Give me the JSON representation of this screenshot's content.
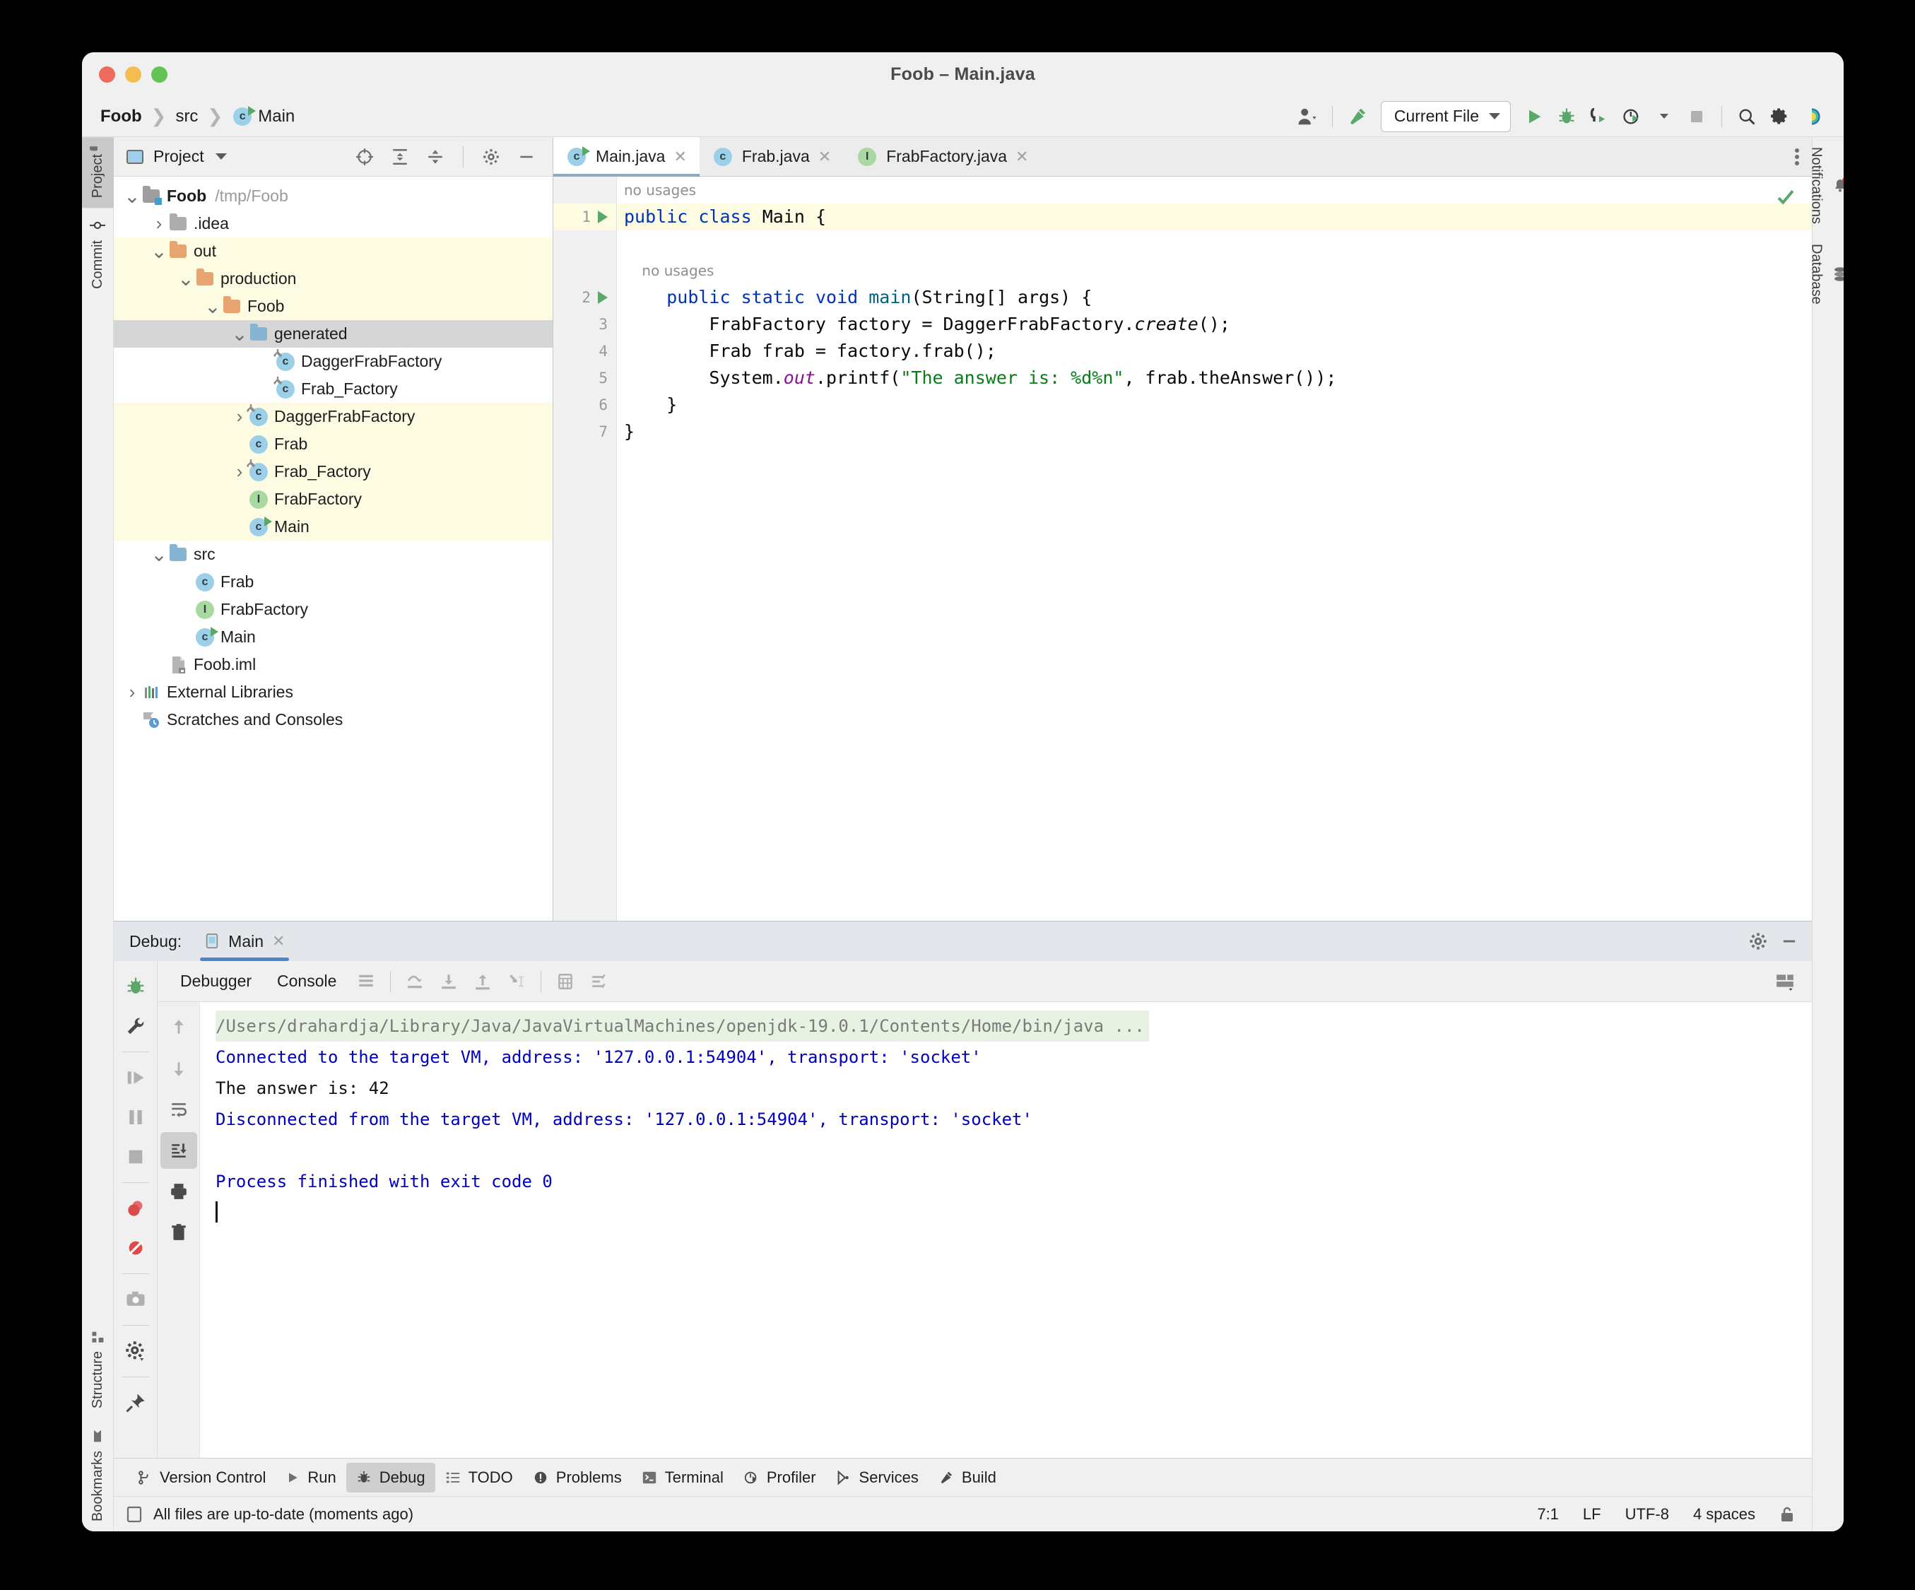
{
  "window": {
    "title": "Foob – Main.java"
  },
  "navbar": {
    "breadcrumbs": [
      {
        "label": "Foob",
        "icon": null,
        "bold": true
      },
      {
        "label": "src",
        "icon": null,
        "bold": false
      },
      {
        "label": "Main",
        "icon": "java-class-run-icon",
        "bold": false
      }
    ],
    "separator": "❯",
    "run_config": {
      "label": "Current File",
      "icon": "chevron-down-icon"
    },
    "buttons": [
      {
        "name": "account-icon",
        "label": ""
      },
      {
        "name": "build-hammer-icon",
        "label": ""
      },
      {
        "name": "run-icon",
        "label": ""
      },
      {
        "name": "debug-icon",
        "label": ""
      },
      {
        "name": "run-with-coverage-icon",
        "label": ""
      },
      {
        "name": "profiler-icon",
        "label": ""
      },
      {
        "name": "stop-icon",
        "label": ""
      },
      {
        "name": "search-icon",
        "label": ""
      },
      {
        "name": "settings-gear-icon",
        "label": ""
      },
      {
        "name": "ai-assistant-icon",
        "label": ""
      }
    ]
  },
  "left_rail": {
    "top": [
      {
        "label": "Project",
        "icon": "project-folder-icon",
        "active": true
      },
      {
        "label": "Commit",
        "icon": "commit-icon",
        "active": false
      }
    ],
    "bottom": [
      {
        "label": "Structure",
        "icon": "structure-icon",
        "active": false
      },
      {
        "label": "Bookmarks",
        "icon": "bookmark-icon",
        "active": false
      }
    ]
  },
  "right_rail": {
    "items": [
      {
        "label": "Notifications",
        "icon": "notifications-bell-icon"
      },
      {
        "label": "Database",
        "icon": "database-icon"
      }
    ]
  },
  "project_panel": {
    "title": "Project",
    "tools": [
      "locate-icon",
      "expand-all-icon",
      "collapse-all-icon",
      "settings-gear-icon",
      "hide-icon"
    ],
    "tree": [
      {
        "depth": 0,
        "label": "Foob",
        "suffix": "/tmp/Foob",
        "icon": "module-folder-icon",
        "arrow": "down",
        "bold": true,
        "hl": "none"
      },
      {
        "depth": 1,
        "label": ".idea",
        "suffix": "",
        "icon": "folder-grey-icon",
        "arrow": "right",
        "bold": false,
        "hl": "none"
      },
      {
        "depth": 1,
        "label": "out",
        "suffix": "",
        "icon": "folder-orange-icon",
        "arrow": "down",
        "bold": false,
        "hl": "yellow"
      },
      {
        "depth": 2,
        "label": "production",
        "suffix": "",
        "icon": "folder-orange-icon",
        "arrow": "down",
        "bold": false,
        "hl": "yellow"
      },
      {
        "depth": 3,
        "label": "Foob",
        "suffix": "",
        "icon": "folder-orange-icon",
        "arrow": "down",
        "bold": false,
        "hl": "yellow"
      },
      {
        "depth": 4,
        "label": "generated",
        "suffix": "",
        "icon": "folder-blue-icon",
        "arrow": "down",
        "bold": false,
        "hl": "grey"
      },
      {
        "depth": 5,
        "label": "DaggerFrabFactory",
        "suffix": "",
        "icon": "class-generated-icon",
        "arrow": "none",
        "bold": false,
        "hl": "none"
      },
      {
        "depth": 5,
        "label": "Frab_Factory",
        "suffix": "",
        "icon": "class-generated-icon",
        "arrow": "none",
        "bold": false,
        "hl": "none"
      },
      {
        "depth": 4,
        "label": "DaggerFrabFactory",
        "suffix": "",
        "icon": "class-generated-icon",
        "arrow": "right",
        "bold": false,
        "hl": "yellow"
      },
      {
        "depth": 4,
        "label": "Frab",
        "suffix": "",
        "icon": "class-icon",
        "arrow": "none",
        "bold": false,
        "hl": "yellow"
      },
      {
        "depth": 4,
        "label": "Frab_Factory",
        "suffix": "",
        "icon": "class-generated-icon",
        "arrow": "right",
        "bold": false,
        "hl": "yellow"
      },
      {
        "depth": 4,
        "label": "FrabFactory",
        "suffix": "",
        "icon": "interface-icon",
        "arrow": "none",
        "bold": false,
        "hl": "yellow"
      },
      {
        "depth": 4,
        "label": "Main",
        "suffix": "",
        "icon": "class-run-icon",
        "arrow": "none",
        "bold": false,
        "hl": "yellow"
      },
      {
        "depth": 1,
        "label": "src",
        "suffix": "",
        "icon": "folder-blue-icon",
        "arrow": "down",
        "bold": false,
        "hl": "none"
      },
      {
        "depth": 2,
        "label": "Frab",
        "suffix": "",
        "icon": "class-icon",
        "arrow": "none",
        "bold": false,
        "hl": "none"
      },
      {
        "depth": 2,
        "label": "FrabFactory",
        "suffix": "",
        "icon": "interface-icon",
        "arrow": "none",
        "bold": false,
        "hl": "none"
      },
      {
        "depth": 2,
        "label": "Main",
        "suffix": "",
        "icon": "class-run-icon",
        "arrow": "none",
        "bold": false,
        "hl": "none"
      },
      {
        "depth": 1,
        "label": "Foob.iml",
        "suffix": "",
        "icon": "iml-file-icon",
        "arrow": "none",
        "bold": false,
        "hl": "none"
      },
      {
        "depth": 0,
        "label": "External Libraries",
        "suffix": "",
        "icon": "libraries-icon",
        "arrow": "right",
        "bold": false,
        "hl": "none"
      },
      {
        "depth": 0,
        "label": "Scratches and Consoles",
        "suffix": "",
        "icon": "scratches-icon",
        "arrow": "none",
        "bold": false,
        "hl": "none"
      }
    ]
  },
  "editor": {
    "tabs": [
      {
        "label": "Main.java",
        "icon": "class-run-icon",
        "active": true
      },
      {
        "label": "Frab.java",
        "icon": "class-icon",
        "active": false
      },
      {
        "label": "FrabFactory.java",
        "icon": "interface-icon",
        "active": false
      }
    ],
    "inspection_status": "ok-checkmark-icon",
    "gutter_lines": [
      "1",
      "2",
      "3",
      "4",
      "5",
      "6",
      "7"
    ],
    "hints": {
      "no_usages": "no usages"
    },
    "code_lines": [
      {
        "num": "",
        "type": "hint",
        "text": "no usages"
      },
      {
        "num": "1",
        "type": "code",
        "highlight": true,
        "run": true,
        "tokens": [
          {
            "t": "public",
            "c": "kw"
          },
          {
            "t": " ",
            "c": ""
          },
          {
            "t": "class",
            "c": "kw"
          },
          {
            "t": " Main {",
            "c": ""
          }
        ]
      },
      {
        "num": "",
        "type": "blank",
        "text": ""
      },
      {
        "num": "",
        "type": "hint",
        "text": "no usages",
        "indent": 1
      },
      {
        "num": "2",
        "type": "code",
        "highlight": false,
        "run": true,
        "fold": "open",
        "tokens": [
          {
            "t": "    ",
            "c": ""
          },
          {
            "t": "public",
            "c": "kw"
          },
          {
            "t": " ",
            "c": ""
          },
          {
            "t": "static",
            "c": "kw"
          },
          {
            "t": " ",
            "c": ""
          },
          {
            "t": "void",
            "c": "kw"
          },
          {
            "t": " ",
            "c": ""
          },
          {
            "t": "main",
            "c": "mth"
          },
          {
            "t": "(String[] args) {",
            "c": ""
          }
        ]
      },
      {
        "num": "3",
        "type": "code",
        "highlight": false,
        "tokens": [
          {
            "t": "        FrabFactory factory = DaggerFrabFactory.",
            "c": ""
          },
          {
            "t": "create",
            "c": "ital"
          },
          {
            "t": "();",
            "c": ""
          }
        ]
      },
      {
        "num": "4",
        "type": "code",
        "highlight": false,
        "tokens": [
          {
            "t": "        Frab frab = factory.frab();",
            "c": ""
          }
        ]
      },
      {
        "num": "5",
        "type": "code",
        "highlight": false,
        "tokens": [
          {
            "t": "        System.",
            "c": ""
          },
          {
            "t": "out",
            "c": "fld"
          },
          {
            "t": ".printf(",
            "c": ""
          },
          {
            "t": "\"The answer is: %d%n\"",
            "c": "str"
          },
          {
            "t": ", frab.theAnswer());",
            "c": ""
          }
        ]
      },
      {
        "num": "6",
        "type": "code",
        "highlight": false,
        "fold": "close",
        "tokens": [
          {
            "t": "    }",
            "c": ""
          }
        ]
      },
      {
        "num": "7",
        "type": "code",
        "highlight": false,
        "tokens": [
          {
            "t": "}",
            "c": ""
          }
        ]
      }
    ]
  },
  "debug": {
    "header_label": "Debug:",
    "session_tab": "Main",
    "session_icon": "run-config-icon",
    "header_buttons": [
      "settings-gear-icon",
      "minimize-icon"
    ],
    "tabs": [
      {
        "label": "Debugger",
        "active": false
      },
      {
        "label": "Console",
        "active": true
      }
    ],
    "toolbar_icons": [
      "layout-icon",
      "step-over-icon",
      "step-into-icon",
      "step-out-icon",
      "run-to-cursor-icon",
      "evaluate-expression-icon",
      "settings-lines-icon"
    ],
    "rail_icons": [
      "debug-bug-icon",
      "wrench-icon",
      "resume-program-icon",
      "pause-program-icon",
      "stop-program-icon",
      "view-breakpoints-icon",
      "mute-breakpoints-icon",
      "camera-icon",
      "settings-gear-icon",
      "pin-icon"
    ],
    "console_side_icons": [
      "scroll-up-icon",
      "scroll-down-icon",
      "soft-wrap-icon",
      "scroll-to-end-icon",
      "print-icon",
      "clear-all-icon"
    ],
    "console": [
      {
        "type": "cmd",
        "text": "/Users/drahardja/Library/Java/JavaVirtualMachines/openjdk-19.0.1/Contents/Home/bin/java ..."
      },
      {
        "type": "sys",
        "text": "Connected to the target VM, address: '127.0.0.1:54904', transport: 'socket'"
      },
      {
        "type": "out",
        "text": "The answer is: 42"
      },
      {
        "type": "sys",
        "text": "Disconnected from the target VM, address: '127.0.0.1:54904', transport: 'socket'"
      },
      {
        "type": "blank",
        "text": ""
      },
      {
        "type": "sys",
        "text": "Process finished with exit code 0"
      },
      {
        "type": "caret",
        "text": ""
      }
    ]
  },
  "tool_window_bar": {
    "items": [
      {
        "label": "Version Control",
        "icon": "version-control-icon",
        "active": false
      },
      {
        "label": "Run",
        "icon": "run-icon",
        "active": false
      },
      {
        "label": "Debug",
        "icon": "debug-bug-icon",
        "active": true
      },
      {
        "label": "TODO",
        "icon": "todo-icon",
        "active": false
      },
      {
        "label": "Problems",
        "icon": "problems-icon",
        "active": false
      },
      {
        "label": "Terminal",
        "icon": "terminal-icon",
        "active": false
      },
      {
        "label": "Profiler",
        "icon": "profiler-icon",
        "active": false
      },
      {
        "label": "Services",
        "icon": "services-icon",
        "active": false
      },
      {
        "label": "Build",
        "icon": "build-hammer-icon",
        "active": false
      }
    ]
  },
  "status_bar": {
    "message": "All files are up-to-date (moments ago)",
    "left_icon": "status-doc-icon",
    "caret_position": "7:1",
    "line_separator": "LF",
    "encoding": "UTF-8",
    "indent": "4 spaces",
    "lock_icon": "unlocked-icon"
  },
  "colors": {
    "accent_green": "#59a869",
    "accent_blue": "#4a86c8",
    "keyword": "#0033b3",
    "string": "#067d17",
    "field": "#871094",
    "method": "#00627a",
    "highlight_yellow": "#fdfce3",
    "selection_grey": "#d6d6d6",
    "console_system": "#0000c0"
  }
}
